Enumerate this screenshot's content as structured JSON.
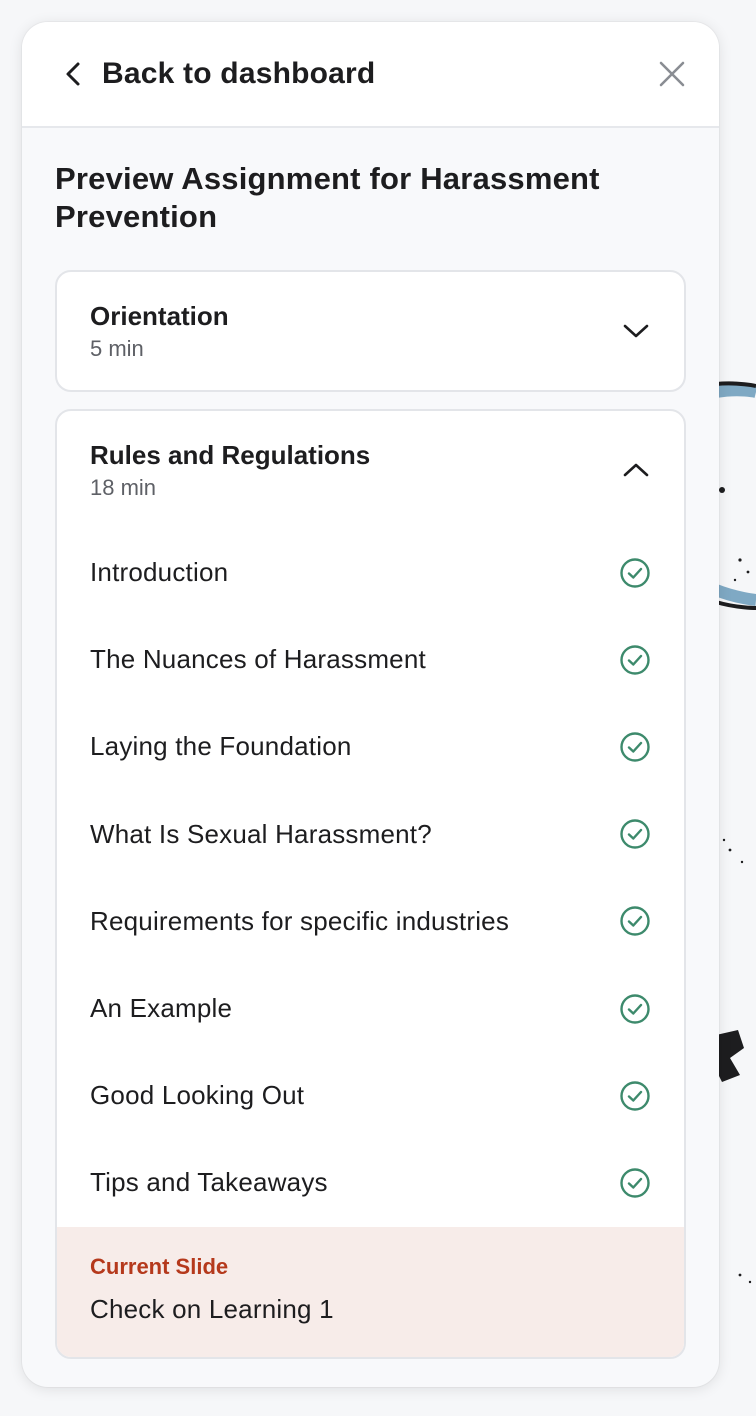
{
  "header": {
    "back_label": "Back to dashboard"
  },
  "page_title": "Preview Assignment for Harassment Prevention",
  "modules": [
    {
      "title": "Orientation",
      "duration": "5 min",
      "expanded": false
    },
    {
      "title": "Rules and Regulations",
      "duration": "18 min",
      "expanded": true,
      "lessons": [
        {
          "title": "Introduction",
          "completed": true
        },
        {
          "title": "The Nuances of Harassment",
          "completed": true
        },
        {
          "title": "Laying the Foundation",
          "completed": true
        },
        {
          "title": "What Is Sexual Harassment?",
          "completed": true
        },
        {
          "title": "Requirements for specific industries",
          "completed": true
        },
        {
          "title": "An Example",
          "completed": true
        },
        {
          "title": "Good Looking Out",
          "completed": true
        },
        {
          "title": "Tips and Takeaways",
          "completed": true
        }
      ],
      "current_slide": {
        "label": "Current Slide",
        "title": "Check on Learning 1"
      }
    }
  ],
  "icons": {
    "back": "chevron-left-icon",
    "close": "close-icon",
    "collapsed": "chevron-down-icon",
    "expanded": "chevron-up-icon",
    "completed": "check-circle-icon"
  },
  "colors": {
    "check": "#3d8a6c",
    "current_label": "#b5391c",
    "current_bg": "#f7ece9"
  }
}
